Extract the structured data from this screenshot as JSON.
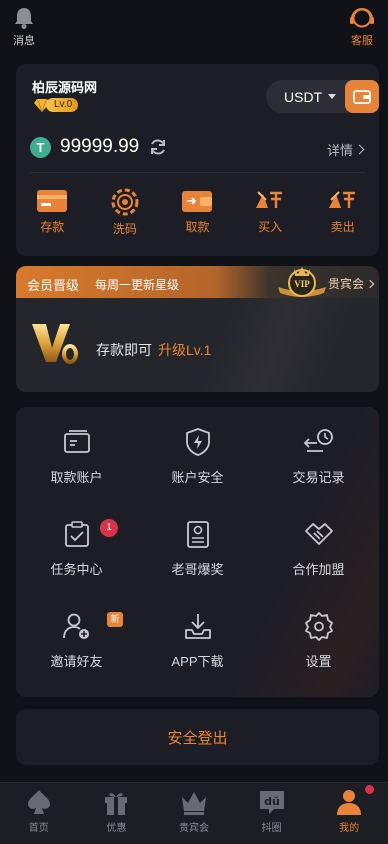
{
  "topbar": {
    "messages_label": "消息",
    "support_label": "客服"
  },
  "user": {
    "site_name": "柏辰源码网",
    "level": "Lv.0",
    "currency": "USDT",
    "balance": "99999.99",
    "details_label": "详情"
  },
  "quick_actions": [
    {
      "label": "存款",
      "icon": "deposit-card-icon"
    },
    {
      "label": "洗码",
      "icon": "chip-icon"
    },
    {
      "label": "取款",
      "icon": "wallet-withdraw-icon"
    },
    {
      "label": "买入",
      "icon": "buy-icon"
    },
    {
      "label": "卖出",
      "icon": "sell-icon"
    }
  ],
  "vip": {
    "title": "会员晋级",
    "subtitle": "每周一更新星级",
    "club_label": "贵宾会",
    "level_text": "存款即可",
    "upgrade_text": "升级Lv.1"
  },
  "menu": [
    {
      "label": "取款账户",
      "icon": "card-account-icon"
    },
    {
      "label": "账户安全",
      "icon": "shield-bolt-icon"
    },
    {
      "label": "交易记录",
      "icon": "clock-record-icon"
    },
    {
      "label": "任务中心",
      "icon": "task-clipboard-icon",
      "badge": "1"
    },
    {
      "label": "老哥爆奖",
      "icon": "poster-icon"
    },
    {
      "label": "合作加盟",
      "icon": "handshake-icon"
    },
    {
      "label": "邀请好友",
      "icon": "invite-user-icon",
      "badge": "新"
    },
    {
      "label": "APP下载",
      "icon": "download-icon"
    },
    {
      "label": "设置",
      "icon": "gear-icon"
    }
  ],
  "logout_label": "安全登出",
  "tabs": [
    {
      "label": "首页",
      "icon": "spade-icon"
    },
    {
      "label": "优惠",
      "icon": "gift-icon"
    },
    {
      "label": "贵宾会",
      "icon": "crown-icon"
    },
    {
      "label": "抖圈",
      "icon": "du-chat-icon"
    },
    {
      "label": "我的",
      "icon": "user-icon",
      "active": true
    }
  ],
  "colors": {
    "accent": "#e8833a",
    "background": "#111217",
    "card": "#1d1e25",
    "badge": "#d8334a"
  }
}
